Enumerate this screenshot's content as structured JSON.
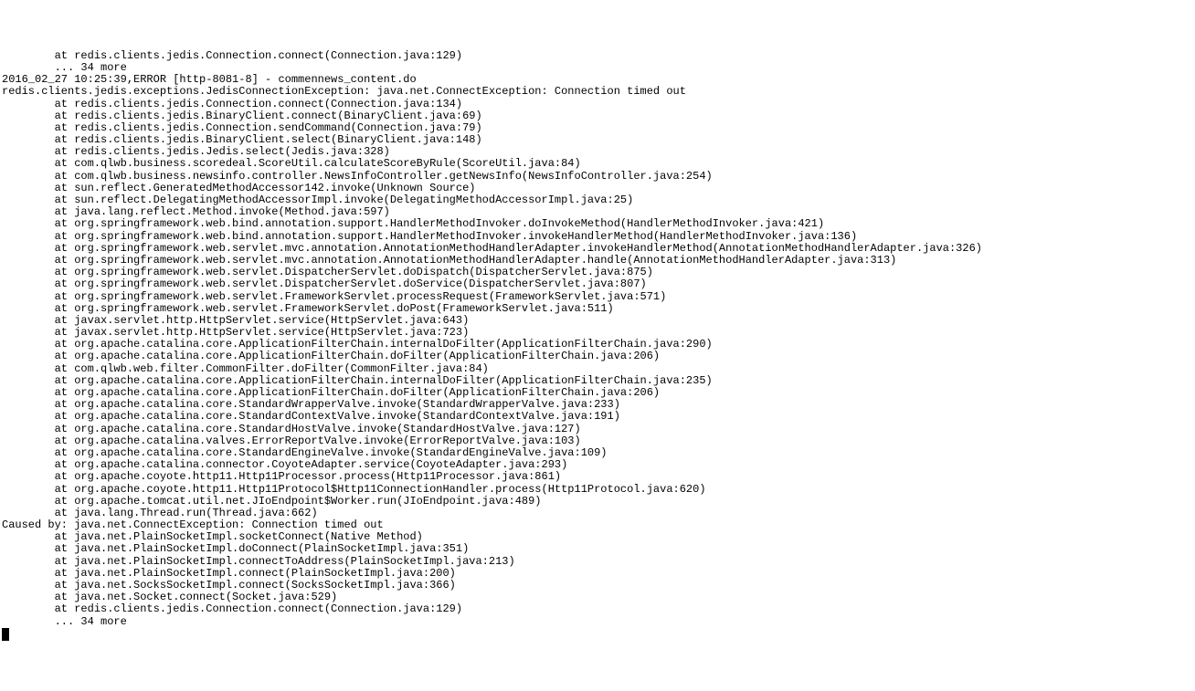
{
  "log": {
    "lines": [
      "        at redis.clients.jedis.Connection.connect(Connection.java:129)",
      "        ... 34 more",
      "2016_02_27 10:25:39,ERROR [http-8081-8] - commennews_content.do",
      "redis.clients.jedis.exceptions.JedisConnectionException: java.net.ConnectException: Connection timed out",
      "        at redis.clients.jedis.Connection.connect(Connection.java:134)",
      "        at redis.clients.jedis.BinaryClient.connect(BinaryClient.java:69)",
      "        at redis.clients.jedis.Connection.sendCommand(Connection.java:79)",
      "        at redis.clients.jedis.BinaryClient.select(BinaryClient.java:148)",
      "        at redis.clients.jedis.Jedis.select(Jedis.java:328)",
      "        at com.qlwb.business.scoredeal.ScoreUtil.calculateScoreByRule(ScoreUtil.java:84)",
      "        at com.qlwb.business.newsinfo.controller.NewsInfoController.getNewsInfo(NewsInfoController.java:254)",
      "        at sun.reflect.GeneratedMethodAccessor142.invoke(Unknown Source)",
      "        at sun.reflect.DelegatingMethodAccessorImpl.invoke(DelegatingMethodAccessorImpl.java:25)",
      "        at java.lang.reflect.Method.invoke(Method.java:597)",
      "        at org.springframework.web.bind.annotation.support.HandlerMethodInvoker.doInvokeMethod(HandlerMethodInvoker.java:421)",
      "        at org.springframework.web.bind.annotation.support.HandlerMethodInvoker.invokeHandlerMethod(HandlerMethodInvoker.java:136)",
      "        at org.springframework.web.servlet.mvc.annotation.AnnotationMethodHandlerAdapter.invokeHandlerMethod(AnnotationMethodHandlerAdapter.java:326)",
      "        at org.springframework.web.servlet.mvc.annotation.AnnotationMethodHandlerAdapter.handle(AnnotationMethodHandlerAdapter.java:313)",
      "        at org.springframework.web.servlet.DispatcherServlet.doDispatch(DispatcherServlet.java:875)",
      "        at org.springframework.web.servlet.DispatcherServlet.doService(DispatcherServlet.java:807)",
      "        at org.springframework.web.servlet.FrameworkServlet.processRequest(FrameworkServlet.java:571)",
      "        at org.springframework.web.servlet.FrameworkServlet.doPost(FrameworkServlet.java:511)",
      "        at javax.servlet.http.HttpServlet.service(HttpServlet.java:643)",
      "        at javax.servlet.http.HttpServlet.service(HttpServlet.java:723)",
      "        at org.apache.catalina.core.ApplicationFilterChain.internalDoFilter(ApplicationFilterChain.java:290)",
      "        at org.apache.catalina.core.ApplicationFilterChain.doFilter(ApplicationFilterChain.java:206)",
      "        at com.qlwb.web.filter.CommonFilter.doFilter(CommonFilter.java:84)",
      "        at org.apache.catalina.core.ApplicationFilterChain.internalDoFilter(ApplicationFilterChain.java:235)",
      "        at org.apache.catalina.core.ApplicationFilterChain.doFilter(ApplicationFilterChain.java:206)",
      "        at org.apache.catalina.core.StandardWrapperValve.invoke(StandardWrapperValve.java:233)",
      "        at org.apache.catalina.core.StandardContextValve.invoke(StandardContextValve.java:191)",
      "        at org.apache.catalina.core.StandardHostValve.invoke(StandardHostValve.java:127)",
      "        at org.apache.catalina.valves.ErrorReportValve.invoke(ErrorReportValve.java:103)",
      "        at org.apache.catalina.core.StandardEngineValve.invoke(StandardEngineValve.java:109)",
      "        at org.apache.catalina.connector.CoyoteAdapter.service(CoyoteAdapter.java:293)",
      "        at org.apache.coyote.http11.Http11Processor.process(Http11Processor.java:861)",
      "        at org.apache.coyote.http11.Http11Protocol$Http11ConnectionHandler.process(Http11Protocol.java:620)",
      "        at org.apache.tomcat.util.net.JIoEndpoint$Worker.run(JIoEndpoint.java:489)",
      "        at java.lang.Thread.run(Thread.java:662)",
      "Caused by: java.net.ConnectException: Connection timed out",
      "        at java.net.PlainSocketImpl.socketConnect(Native Method)",
      "        at java.net.PlainSocketImpl.doConnect(PlainSocketImpl.java:351)",
      "        at java.net.PlainSocketImpl.connectToAddress(PlainSocketImpl.java:213)",
      "        at java.net.PlainSocketImpl.connect(PlainSocketImpl.java:200)",
      "        at java.net.SocksSocketImpl.connect(SocksSocketImpl.java:366)",
      "        at java.net.Socket.connect(Socket.java:529)",
      "        at redis.clients.jedis.Connection.connect(Connection.java:129)",
      "        ... 34 more"
    ]
  }
}
